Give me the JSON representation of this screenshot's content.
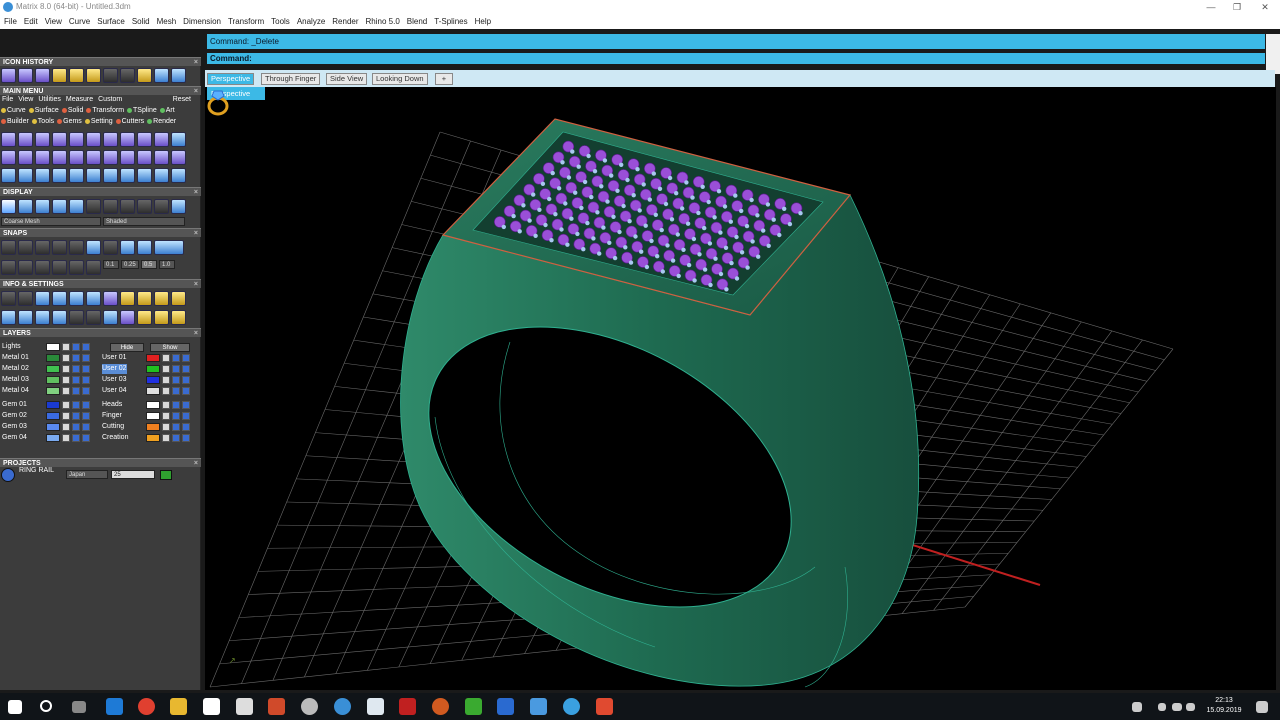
{
  "window": {
    "title": "Matrix 8.0 (64-bit) - Untitled.3dm"
  },
  "menu": [
    "File",
    "Edit",
    "View",
    "Curve",
    "Surface",
    "Solid",
    "Mesh",
    "Dimension",
    "Transform",
    "Tools",
    "Analyze",
    "Render",
    "Rhino 5.0",
    "Blend",
    "T-Splines",
    "Help"
  ],
  "panel": {
    "icon_history": "ICON HISTORY",
    "main_menu": "MAIN MENU",
    "main_links": [
      "File",
      "View",
      "Utilities",
      "Measure",
      "Custom"
    ],
    "reset": "Reset",
    "categories_row1": [
      "Curve",
      "Surface",
      "Solid",
      "Transform",
      "TSpline",
      "Art"
    ],
    "categories_row2": [
      "Builder",
      "Tools",
      "Gems",
      "Setting",
      "Cutters",
      "Render"
    ],
    "display": "DISPLAY",
    "display_mode_left": "Coarse Mesh",
    "display_mode_right": "Shaded",
    "snaps": "SNAPS",
    "snap_values": [
      "0.1",
      "0.25",
      "0.5",
      "1.0"
    ],
    "info_settings": "INFO & SETTINGS",
    "layers": "LAYERS",
    "lights": "Lights",
    "hide": "Hide",
    "show": "Show",
    "layers_left": [
      "Metal 01",
      "Metal 02",
      "Metal 03",
      "Metal 04",
      "Gem 01",
      "Gem 02",
      "Gem 03",
      "Gem 04"
    ],
    "layers_right": [
      "User 01",
      "User 02",
      "User 03",
      "User 04",
      "Heads",
      "Finger",
      "Cutting",
      "Creation"
    ],
    "projects": "PROJECTS",
    "project_name": "RING RAIL",
    "project_region": "Japan",
    "project_size": "25"
  },
  "command": {
    "history": "Command: _Delete",
    "prompt": "Command:"
  },
  "tabs": [
    "Perspective",
    "Through Finger",
    "Side View",
    "Looking Down"
  ],
  "viewport_label": "Perspective",
  "clock": {
    "time": "22:13",
    "date": "15.09.2019"
  },
  "colors": {
    "accent": "#3cb9e6",
    "ring": "#1f6b52",
    "gems": "#9a4fd8"
  }
}
